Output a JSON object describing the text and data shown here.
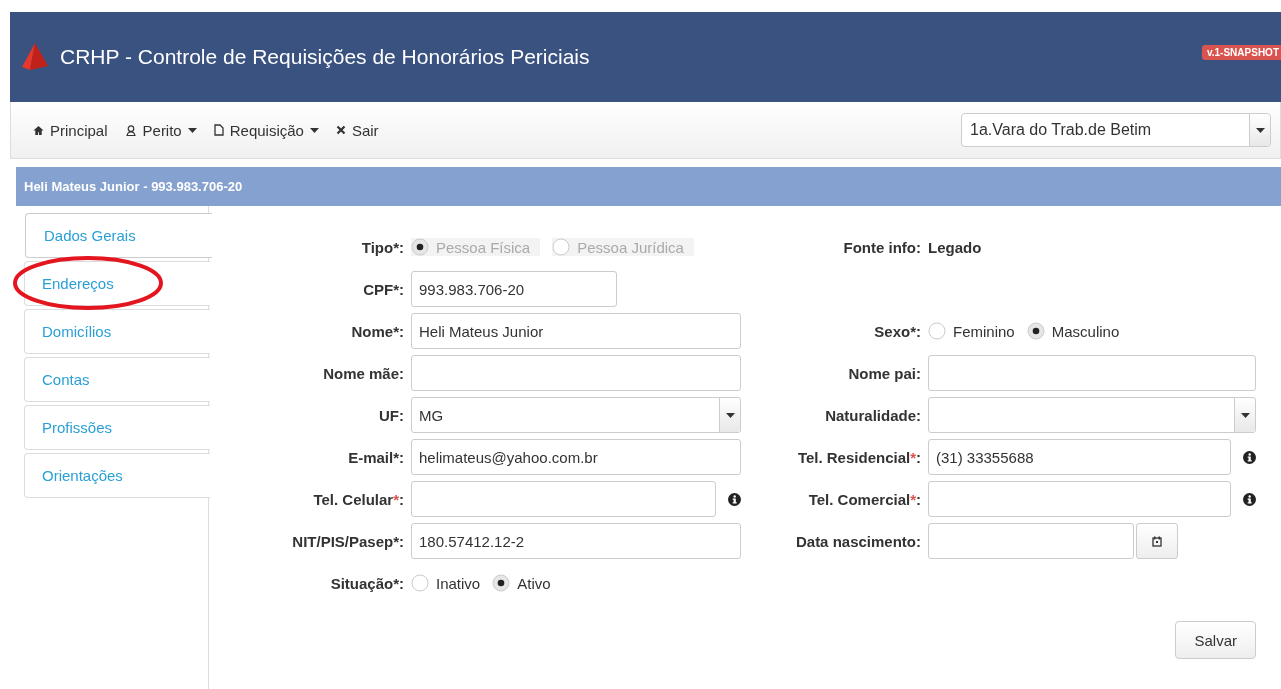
{
  "header": {
    "title": "CRHP - Controle de Requisições de Honorários Periciais",
    "version_badge": "v.1-SNAPSHOT"
  },
  "nav": {
    "items": [
      {
        "label": "Principal",
        "dropdown": false
      },
      {
        "label": "Perito",
        "dropdown": true
      },
      {
        "label": "Requisição",
        "dropdown": true
      },
      {
        "label": "Sair",
        "dropdown": false
      }
    ],
    "court_select": {
      "value": "1a.Vara do Trab.de Betim"
    }
  },
  "person_bar": {
    "title": "Heli Mateus Junior - 993.983.706-20"
  },
  "tabs": [
    {
      "label": "Dados Gerais",
      "selected": true,
      "circled": false
    },
    {
      "label": "Endereços",
      "selected": false,
      "circled": true
    },
    {
      "label": "Domicílios",
      "selected": false,
      "circled": false
    },
    {
      "label": "Contas",
      "selected": false,
      "circled": false
    },
    {
      "label": "Profissões",
      "selected": false,
      "circled": false
    },
    {
      "label": "Orientações",
      "selected": false,
      "circled": false
    }
  ],
  "form": {
    "rows": [
      {
        "left": {
          "kind": "radio",
          "label": "Tipo*:",
          "disabled": true,
          "options": [
            {
              "label": "Pessoa Física",
              "selected": true
            },
            {
              "label": "Pessoa Jurídica",
              "selected": false
            }
          ]
        },
        "right": {
          "kind": "static",
          "label": "Fonte info:",
          "value": "Legado"
        }
      },
      {
        "left": {
          "kind": "text",
          "label": "CPF*:",
          "value": "993.983.706-20",
          "short": true
        }
      },
      {
        "left": {
          "kind": "text",
          "label": "Nome*:",
          "value": "Heli Mateus Junior"
        },
        "right": {
          "kind": "radio",
          "label": "Sexo*:",
          "disabled": false,
          "options": [
            {
              "label": "Feminino",
              "selected": false
            },
            {
              "label": "Masculino",
              "selected": true
            }
          ]
        }
      },
      {
        "left": {
          "kind": "text",
          "label": "Nome mãe:"
        },
        "right": {
          "kind": "text",
          "label": "Nome pai:"
        }
      },
      {
        "left": {
          "kind": "select",
          "label": "UF:",
          "value": "MG"
        },
        "right": {
          "kind": "select",
          "label": "Naturalidade:"
        }
      },
      {
        "left": {
          "kind": "text",
          "label": "E-mail*:",
          "value": "helimateus@yahoo.com.br"
        },
        "right": {
          "kind": "text",
          "label": "Tel. Residencial",
          "asterisk": "*",
          "tail": ":",
          "value": "(31) 33355688",
          "info": true
        }
      },
      {
        "left": {
          "kind": "text",
          "label": "Tel. Celular",
          "asterisk": "*",
          "tail": ":",
          "info": true
        },
        "right": {
          "kind": "text",
          "label": "Tel. Comercial",
          "asterisk": "*",
          "tail": ":",
          "info": true
        }
      },
      {
        "left": {
          "kind": "text",
          "label": "NIT/PIS/Pasep*:",
          "value": "180.57412.12-2"
        },
        "right": {
          "kind": "date",
          "label": "Data nascimento:"
        }
      },
      {
        "left": {
          "kind": "radio",
          "label": "Situação*:",
          "disabled": false,
          "options": [
            {
              "label": "Inativo",
              "selected": false
            },
            {
              "label": "Ativo",
              "selected": true
            }
          ]
        }
      }
    ],
    "save_button": "Salvar"
  }
}
